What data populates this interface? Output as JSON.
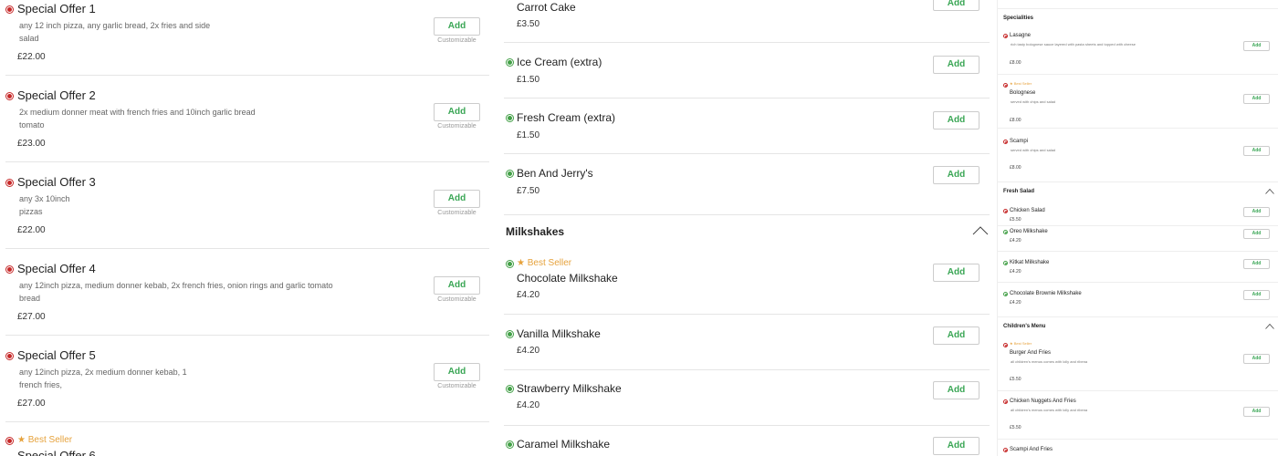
{
  "colors": {
    "accent": "#3aa655",
    "nonveg": "#c62828",
    "veg": "#43a047",
    "bestseller": "#e6a23c"
  },
  "add_label": "Add",
  "custom_label": "Customizable",
  "best_seller_label": "Best Seller",
  "col1": {
    "items": [
      {
        "name": "Special Offer 1",
        "desc": "any 12 inch pizza, any garlic bread, 2x fries and side salad",
        "price": "£22.00"
      },
      {
        "name": "Special Offer 2",
        "desc": "2x medium donner meat with french fries and 10inch garlic bread tomato",
        "price": "£23.00"
      },
      {
        "name": "Special Offer 3",
        "desc": "any 3x 10inch pizzas",
        "price": "£22.00"
      },
      {
        "name": "Special Offer 4",
        "desc": "any 12inch pizza, medium donner kebab, 2x french fries, onion rings and garlic tomato bread",
        "price": "£27.00"
      },
      {
        "name": "Special Offer 5",
        "desc": "any 12inch pizza, 2x medium donner kebab, 1 french fries,",
        "price": "£27.00"
      }
    ],
    "last_item_name": "Special Offer 6"
  },
  "col2": {
    "items_top": [
      {
        "name": "Carrot Cake",
        "price": "£3.50"
      },
      {
        "name": "Ice Cream (extra)",
        "price": "£1.50"
      },
      {
        "name": "Fresh Cream (extra)",
        "price": "£1.50"
      },
      {
        "name": "Ben And Jerry's",
        "price": "£7.50"
      }
    ],
    "section_title": "Milkshakes",
    "milkshakes": [
      {
        "name": "Chocolate Milkshake",
        "price": "£4.20"
      },
      {
        "name": "Vanilla Milkshake",
        "price": "£4.20"
      },
      {
        "name": "Strawberry Milkshake",
        "price": "£4.20"
      },
      {
        "name": "Caramel Milkshake"
      }
    ]
  },
  "col3": {
    "specialities_title": "Specialities",
    "specialities": [
      {
        "name": "Lasagne",
        "desc": "rich tasty bolognese sauce layered with pasta sheets and topped with cheese",
        "price": "£8.00"
      },
      {
        "name": "Bolognese",
        "desc": "served with chips and salad",
        "price": "£8.00"
      },
      {
        "name": "Scampi",
        "desc": "served with chips and salad",
        "price": "£8.00"
      }
    ],
    "fresh_salad_title": "Fresh Salad",
    "fresh_salad": [
      {
        "name": "Chicken Salad",
        "price": "£5.50"
      },
      {
        "name": "Oreo Milkshake",
        "price": "£4.20"
      },
      {
        "name": "Kitkat Milkshake",
        "price": "£4.20"
      },
      {
        "name": "Chocolate Brownie Milkshake",
        "price": "£4.20"
      }
    ],
    "childrens_title": "Children's Menu",
    "childrens": [
      {
        "name": "Burger And Fries",
        "desc": "all children's menus comes with lolly and ribena",
        "price": "£5.50"
      },
      {
        "name": "Chicken Nuggets And Fries",
        "desc": "all children's menus comes with lolly and ribena",
        "price": "£5.50"
      },
      {
        "name": "Scampi And Fries"
      }
    ]
  }
}
